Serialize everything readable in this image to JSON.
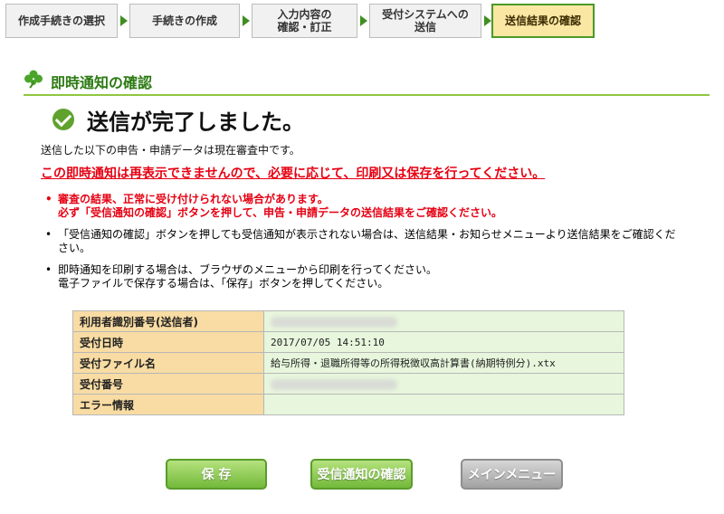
{
  "steps": [
    {
      "label": "作成手続きの選択"
    },
    {
      "label": "手続きの作成"
    },
    {
      "label1": "入力内容の",
      "label2": "確認・訂正"
    },
    {
      "label1": "受付システムへの",
      "label2": "送信"
    },
    {
      "label": "送信結果の確認"
    }
  ],
  "section": {
    "title": "即時通知の確認"
  },
  "completion": {
    "title": "送信が完了しました。"
  },
  "lead": "送信した以下の申告・申請データは現在審査中です。",
  "warning": "この即時通知は再表示できませんので、必要に応じて、印刷又は保存を行ってください。",
  "notes": [
    {
      "line1": "審査の結果、正常に受け付けられない場合があります。",
      "line2": "必ず「受信通知の確認」ボタンを押して、申告・申請データの送信結果をご確認ください。"
    },
    {
      "line1": "「受信通知の確認」ボタンを押しても受信通知が表示されない場合は、送信結果・お知らせメニューより送信結果をご確認くだ",
      "line2": "さい。"
    },
    {
      "line1": "即時通知を印刷する場合は、ブラウザのメニューから印刷を行ってください。",
      "line2": "電子ファイルで保存する場合は、「保存」ボタンを押してください。"
    }
  ],
  "table": {
    "rows": [
      {
        "label": "利用者識別番号(送信者)",
        "value": ""
      },
      {
        "label": "受付日時",
        "value": "2017/07/05 14:51:10"
      },
      {
        "label": "受付ファイル名",
        "value": "給与所得・退職所得等の所得税徴収高計算書(納期特例分).xtx"
      },
      {
        "label": "受付番号",
        "value": ""
      },
      {
        "label": "エラー情報",
        "value": ""
      }
    ]
  },
  "buttons": {
    "save": "保 存",
    "receipt": "受信通知の確認",
    "main_menu": "メインメニュー"
  },
  "icons": {
    "section": "clover-icon",
    "completion": "check-circle-icon"
  },
  "colors": {
    "accent_green": "#5fa22d",
    "warning_red": "#e60012",
    "active_step_bg": "#f9e7a3"
  }
}
